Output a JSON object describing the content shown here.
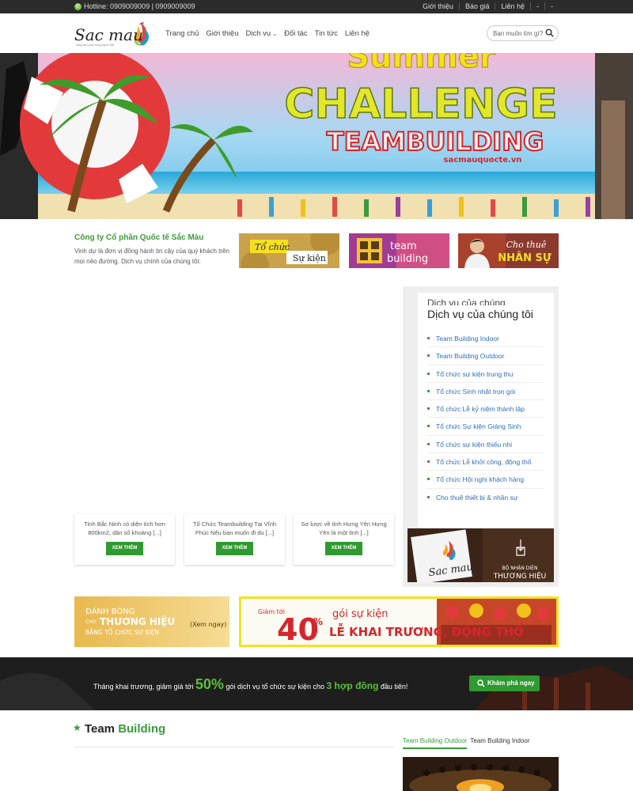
{
  "topbar": {
    "hotline": "Hotline: 0909009009 | 0909009009",
    "links": [
      "Giới thiệu",
      "Báo giá",
      "Liên hệ",
      "-",
      "-"
    ]
  },
  "logo": {
    "text": "Sac mau",
    "tagline": "nâng tầm cuộc sống người việt"
  },
  "nav": [
    "Trang chủ",
    "Giới thiệu",
    "Dịch vụ",
    "Đối tác",
    "Tin tức",
    "Liên hệ"
  ],
  "search": {
    "placeholder": "Bạn muốn tìm gì?"
  },
  "hero": {
    "line1": "Summer",
    "line2": "CHALLENGE",
    "line3": "TEAMBUILDING",
    "url": "sacmauquocte.vn"
  },
  "intro": {
    "title": "Công ty Cổ phần Quốc tế Sắc Màu",
    "desc": "Vinh dự là đơn vị đồng hành tin cậy của quý khách trên mọi nẻo đường. Dịch vụ chính của chúng tôi:"
  },
  "services": [
    {
      "l1": "Tổ chức",
      "l2": "Sự kiện"
    },
    {
      "l1": "team",
      "l2": "building"
    },
    {
      "l1": "Cho thuê",
      "l2": "NHÂN SỰ"
    }
  ],
  "cards": [
    {
      "text": "Tỉnh Bắc Ninh có diện tích hơn 800km2, dân số khoảng [...]",
      "more": "XEM THÊM"
    },
    {
      "text": "Tổ Chức Teambuilding Tại Vĩnh Phúc Nếu bạn muốn đi du [...]",
      "more": "XEM THÊM"
    },
    {
      "text": "Sơ lược về tỉnh Hưng Yên Hưng Yên là một tỉnh [...]",
      "more": "XEM THÊM"
    }
  ],
  "sidebar": {
    "ghost": "Dịch vụ của chúng",
    "title": "Dịch vụ của chúng tôi",
    "items": [
      "Team Building Indoor",
      "Team Building Outdoor",
      "Tổ chức sự kiện trung thu",
      "Tổ chức Sinh nhật trọn gói",
      "Tổ chức Lễ kỷ niệm thành lập",
      "Tổ chức Sự kiện Giáng Sinh",
      "Tổ chức sự kiện thiếu nhi",
      "Tổ chức Lễ khởi công, động thổ",
      "Tổ chức Hội nghị khách hàng",
      "Cho thuê thiết bị & nhân sự"
    ],
    "brand": {
      "l1": "BỘ NHẬN DIỆN",
      "l2": "THƯƠNG HIỆU",
      "logo": "Sac mau"
    }
  },
  "banner1": {
    "l1": "ĐÁNH BÓNG",
    "l2": "CHO",
    "l3": "THƯƠNG HIỆU",
    "l4": "BẰNG TỔ CHỨC SỰ KIỆN",
    "cta": "(Xem ngay)"
  },
  "banner2": {
    "pre": "Giảm tới",
    "pct": "40",
    "unit": "%",
    "l1": "gói sự kiện",
    "l2": "LỄ KHAI TRƯƠNG, ĐỘNG THỔ"
  },
  "promo": {
    "t1": "Tháng khai trương, giảm giá tới ",
    "big": "50%",
    "t2": " gói dịch vụ tổ chức sự kiện cho ",
    "mid": "3 hợp đồng",
    "t3": " đầu tiên!",
    "button": "Khám phá ngay"
  },
  "section": {
    "t1": "Team ",
    "t2": "Building"
  },
  "tabs": [
    "Team Building Outdoor",
    "Team Building Indoor"
  ],
  "colors": {
    "green": "#3c9a3c",
    "topbar": "#2b2b2b",
    "link": "#2d6fb8"
  }
}
